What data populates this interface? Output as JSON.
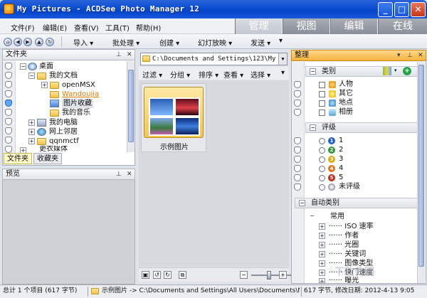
{
  "window": {
    "title": "My Pictures - ACDSee Photo Manager 12"
  },
  "menu": {
    "items": [
      "文件(F)",
      "编辑(E)",
      "查看(V)",
      "工具(T)",
      "帮助(H)"
    ]
  },
  "modes": [
    {
      "label": "管理",
      "active": true
    },
    {
      "label": "视图",
      "active": false
    },
    {
      "label": "编辑",
      "active": false
    },
    {
      "label": "在线",
      "active": false
    }
  ],
  "toolbar": {
    "items": [
      "导入",
      "批处理",
      "创建",
      "幻灯放映",
      "发送"
    ]
  },
  "folders": {
    "header": "文件夹",
    "tree": [
      "桌面",
      "我的文档",
      "openMSX",
      "Wandoujia",
      "图片收藏",
      "我的音乐",
      "我的电脑",
      "网上邻居",
      "qqnmctf",
      "更衣媒体"
    ],
    "tabs": [
      "文件夹",
      "收藏夹"
    ]
  },
  "preview": {
    "header": "预览"
  },
  "browser": {
    "path": "C:\\Documents and Settings\\123\\My Do",
    "filters": [
      "过滤",
      "分组",
      "排序",
      "查看",
      "选择"
    ],
    "thumb_label": "示例图片"
  },
  "organize": {
    "header": "整理",
    "categories_title": "类别",
    "categories": [
      "人物",
      "其它",
      "地点",
      "相册"
    ],
    "ratings_title": "评级",
    "ratings": [
      "1",
      "2",
      "3",
      "4",
      "5",
      "未评级"
    ],
    "auto_title": "自动类别",
    "auto_root": "常用",
    "auto_items": [
      "ISO 速率",
      "作者",
      "光圈",
      "关键词",
      "图像类型",
      "快门速度",
      "曝光"
    ]
  },
  "status": {
    "total": "总计 1 个项目 (617 字节)",
    "path": "示例图片 -> C:\\Documents and Settings\\All Users\\Documents\\My...",
    "info": "617 字节, 修改日期: 2012-4-13 9:05"
  },
  "watermark": {
    "text": "下软件园"
  },
  "colors": {
    "title_bar": "#0543c7",
    "organize_header": "#f5b23d",
    "selected_tab": "#fff8c7",
    "link_orange": "#e07b00"
  }
}
